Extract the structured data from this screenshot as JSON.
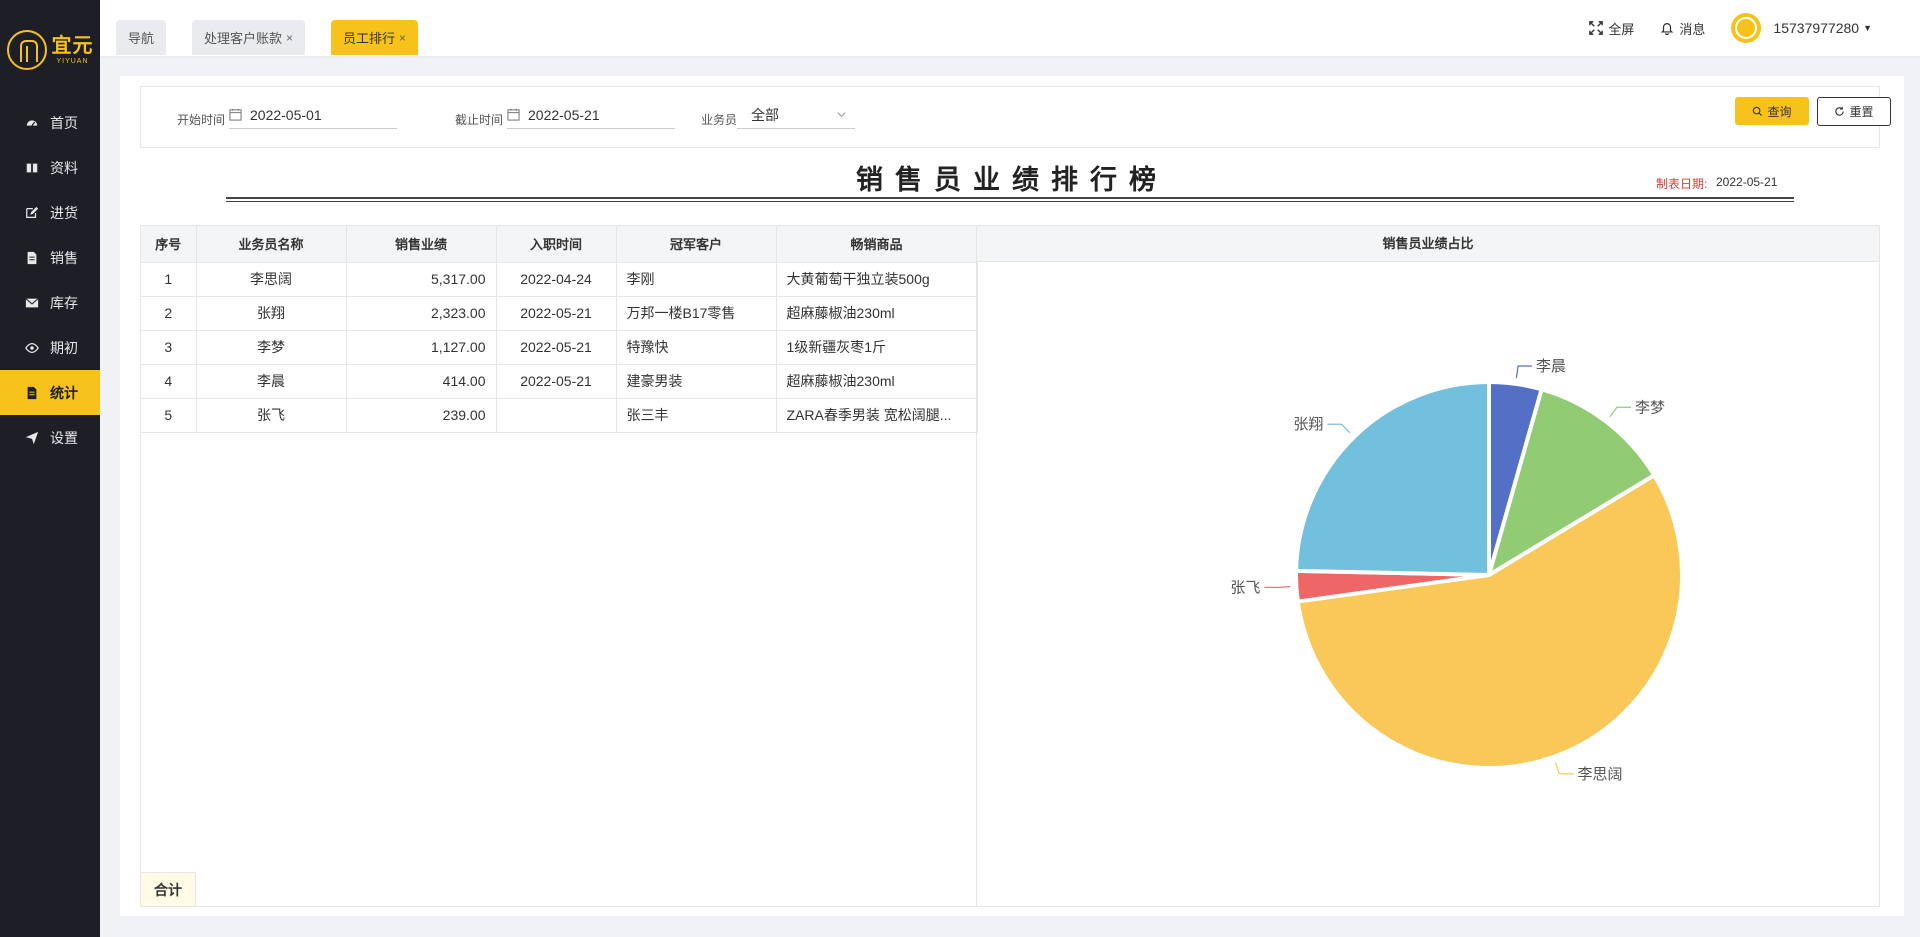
{
  "logo": {
    "cn": "宜元",
    "en": "YIYUAN"
  },
  "nav": [
    {
      "label": "首页",
      "icon": "dashboard-icon"
    },
    {
      "label": "资料",
      "icon": "book-icon"
    },
    {
      "label": "进货",
      "icon": "edit-icon"
    },
    {
      "label": "销售",
      "icon": "file-icon"
    },
    {
      "label": "库存",
      "icon": "mail-icon"
    },
    {
      "label": "期初",
      "icon": "eye-icon"
    },
    {
      "label": "统计",
      "icon": "report-icon"
    },
    {
      "label": "设置",
      "icon": "send-icon"
    }
  ],
  "tabs": [
    {
      "label": "导航"
    },
    {
      "label": "处理客户账款",
      "close": "×"
    },
    {
      "label": "员工排行",
      "close": "×"
    }
  ],
  "header": {
    "fullscreen": "全屏",
    "messages": "消息",
    "user": "15737977280"
  },
  "filters": {
    "start_label": "开始时间",
    "start_value": "2022-05-01",
    "end_label": "截止时间",
    "end_value": "2022-05-21",
    "salesman_label": "业务员",
    "salesman_value": "全部",
    "query": "查询",
    "reset": "重置"
  },
  "report": {
    "title": "销售员业绩排行榜",
    "date_label": "制表日期:",
    "date_value": "2022-05-21"
  },
  "table": {
    "columns": [
      "序号",
      "业务员名称",
      "销售业绩",
      "入职时间",
      "冠军客户",
      "畅销商品"
    ],
    "rows": [
      [
        "1",
        "李思阔",
        "5,317.00",
        "2022-04-24",
        "李刚",
        "大黄葡萄干独立装500g"
      ],
      [
        "2",
        "张翔",
        "2,323.00",
        "2022-05-21",
        "万邦一楼B17零售",
        "超麻藤椒油230ml"
      ],
      [
        "3",
        "李梦",
        "1,127.00",
        "2022-05-21",
        "特豫快",
        "1级新疆灰枣1斤"
      ],
      [
        "4",
        "李晨",
        "414.00",
        "2022-05-21",
        "建豪男装",
        "超麻藤椒油230ml"
      ],
      [
        "5",
        "张飞",
        "239.00",
        "",
        "张三丰",
        "ZARA春季男装 宽松阔腿..."
      ]
    ],
    "total_label": "合计"
  },
  "chart_data": {
    "type": "pie",
    "title": "销售员业绩占比",
    "slices": [
      {
        "name": "李晨",
        "value": 414,
        "color": "#5470c6"
      },
      {
        "name": "李梦",
        "value": 1127,
        "color": "#91cc75"
      },
      {
        "name": "李思阔",
        "value": 5317,
        "color": "#fac858"
      },
      {
        "name": "张飞",
        "value": 239,
        "color": "#ee6666"
      },
      {
        "name": "张翔",
        "value": 2323,
        "color": "#73c0de"
      }
    ]
  }
}
